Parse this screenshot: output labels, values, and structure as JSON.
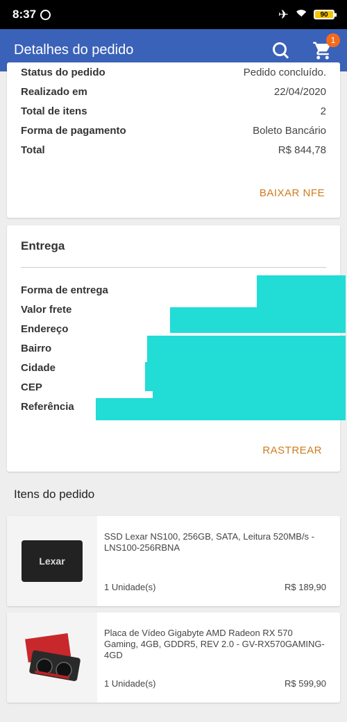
{
  "status_bar": {
    "time": "8:37",
    "battery": "90"
  },
  "app_bar": {
    "title": "Detalhes do pedido",
    "cart_count": "1"
  },
  "order_summary": {
    "rows": [
      {
        "label": "Status do pedido",
        "value": "Pedido concluído."
      },
      {
        "label": "Realizado em",
        "value": "22/04/2020"
      },
      {
        "label": "Total de itens",
        "value": "2"
      },
      {
        "label": "Forma de pagamento",
        "value": "Boleto Bancário"
      },
      {
        "label": "Total",
        "value": "R$ 844,78"
      }
    ],
    "action_label": "BAIXAR NFE"
  },
  "delivery": {
    "heading": "Entrega",
    "rows": [
      {
        "label": "Forma de entrega"
      },
      {
        "label": "Valor frete"
      },
      {
        "label": "Endereço"
      },
      {
        "label": "Bairro"
      },
      {
        "label": "Cidade"
      },
      {
        "label": "CEP"
      },
      {
        "label": "Referência"
      }
    ],
    "action_label": "RASTREAR",
    "redaction_color": "#22dcd6"
  },
  "items_section": {
    "title": "Itens do pedido",
    "items": [
      {
        "name": "SSD Lexar NS100, 256GB, SATA, Leitura 520MB/s - LNS100-256RBNA",
        "quantity": "1 Unidade(s)",
        "price": "R$ 189,90",
        "thumb_text": "Lexar"
      },
      {
        "name": "Placa de Vídeo Gigabyte AMD Radeon RX 570 Gaming, 4GB, GDDR5, REV 2.0 - GV-RX570GAMING-4GD",
        "quantity": "1 Unidade(s)",
        "price": "R$ 599,90"
      }
    ]
  },
  "colors": {
    "app_bar": "#3a62b8",
    "accent_link": "#d07a1c",
    "badge": "#f26b1d"
  }
}
